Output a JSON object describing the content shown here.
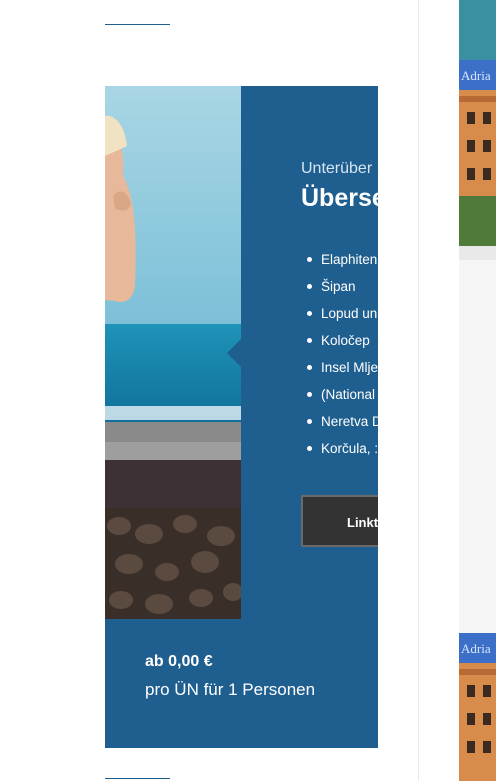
{
  "offer_card": {
    "subtitle": "Unterüber",
    "title": "Überse",
    "features": [
      "Elaphiten",
      "Šipan",
      "Lopud un",
      "Koločep",
      "Insel Mlje",
      "(National",
      "Neretva D",
      "Korčula, :"
    ],
    "link_button_label": "Linkt",
    "price": "ab 0,00 €",
    "price_note": "pro ÜN für 1 Personen"
  },
  "sidebar": {
    "thumbnail_watermark": "Adria"
  },
  "colors": {
    "card_background": "#1f5f8f",
    "button_background": "#333333",
    "accent_rule": "#1f5f8f"
  }
}
